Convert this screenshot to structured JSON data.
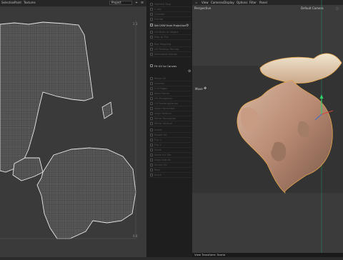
{
  "uv_editor": {
    "menu": [
      "Selection",
      "Paint",
      "Textures"
    ],
    "dropdown": "Project",
    "tick_top": "1 1",
    "tick_bottom": "0 0"
  },
  "commands": {
    "dim_a": [
      "Optimal Map",
      "Cubic",
      "Cylinder",
      "Frontal"
    ],
    "highlight": "Set UVW from Projection",
    "dim_b": [
      "UV Mesh to Object",
      "Map to Tile",
      "Box Mapping",
      "UV Padding Remap",
      "Normalize Islands"
    ],
    "section": "Fit UV to Canvas",
    "dim_c": [
      "Relax UV",
      "Unwrap",
      "Cut Edges",
      "Weld Points",
      "UV Straighten",
      "UV Rectangularize",
      "Align Horizontal",
      "Align Vertical",
      "Mirror Horizontal",
      "Mirror Vertical",
      "Invert",
      "Rotate 90",
      "Flip U",
      "Flip V",
      "Scale",
      "Scale UV Tile",
      "Align Islands",
      "Shrink UV",
      "Pack",
      "Stack"
    ]
  },
  "viewport": {
    "menu": [
      "View",
      "Cameras",
      "Display",
      "Options",
      "Filter",
      "Panel"
    ],
    "view_name": "Perspective",
    "camera": "Default Camera",
    "tool_label": "Move",
    "status": "View Transform: Scene"
  },
  "colors": {
    "uv_bg": "#3a3a3a",
    "mesh_fill": "#4c4c4c",
    "mesh_line": "#d6d6d6",
    "accent": "#c98a3c"
  }
}
